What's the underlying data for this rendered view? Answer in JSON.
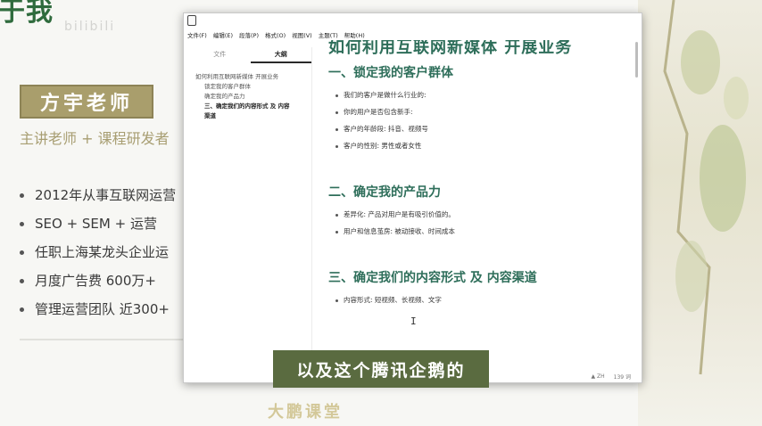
{
  "slide": {
    "title": "于我",
    "name_badge": "方宇老师",
    "role": "主讲老师 + 课程研发者",
    "bio": [
      "2012年从事互联网运营",
      "SEO + SEM + 运营",
      "任职上海某龙头企业运",
      "月度广告费 600万+",
      "管理运营团队 近300+"
    ],
    "brand": "大鹏课堂"
  },
  "app": {
    "menu": [
      "文件(F)",
      "编辑(E)",
      "段落(P)",
      "格式(O)",
      "视图(V)",
      "主题(T)",
      "帮助(H)"
    ],
    "tabs": [
      "文件",
      "大纲"
    ],
    "outline": {
      "root": "如何利用互联网新媒体 开展业务",
      "children": [
        "锁定我的客户群体",
        "确定我的产品力"
      ],
      "current": "三、确定我们的内容形式 及 内容渠道"
    },
    "doc": {
      "title": "如何利用互联网新媒体 开展业务",
      "sections": [
        {
          "heading": "一、锁定我的客户群体",
          "bullets": [
            "我们的客户是做什么行业的:",
            "你的用户是否包含新手:",
            "客户的年龄段: 抖音、视频号",
            "客户的性别: 男性或者女性"
          ]
        },
        {
          "heading": "二、确定我的产品力",
          "bullets": [
            "差异化: 产品对用户是有吸引价值的。",
            "用户和信息茧房: 被动接收、时间成本"
          ]
        },
        {
          "heading": "三、确定我们的内容形式 及 内容渠道",
          "bullets": [
            "内容形式: 短视频、长视频、文字"
          ]
        }
      ]
    },
    "status": {
      "warn": "▲ ZH",
      "words": "139 词"
    }
  },
  "subtitle": "以及这个腾讯企鹅的",
  "colors": {
    "heading_green": "#2e6e5a",
    "badge_olive": "#a99e6c",
    "subtitle_bg": "#5a6b40"
  }
}
